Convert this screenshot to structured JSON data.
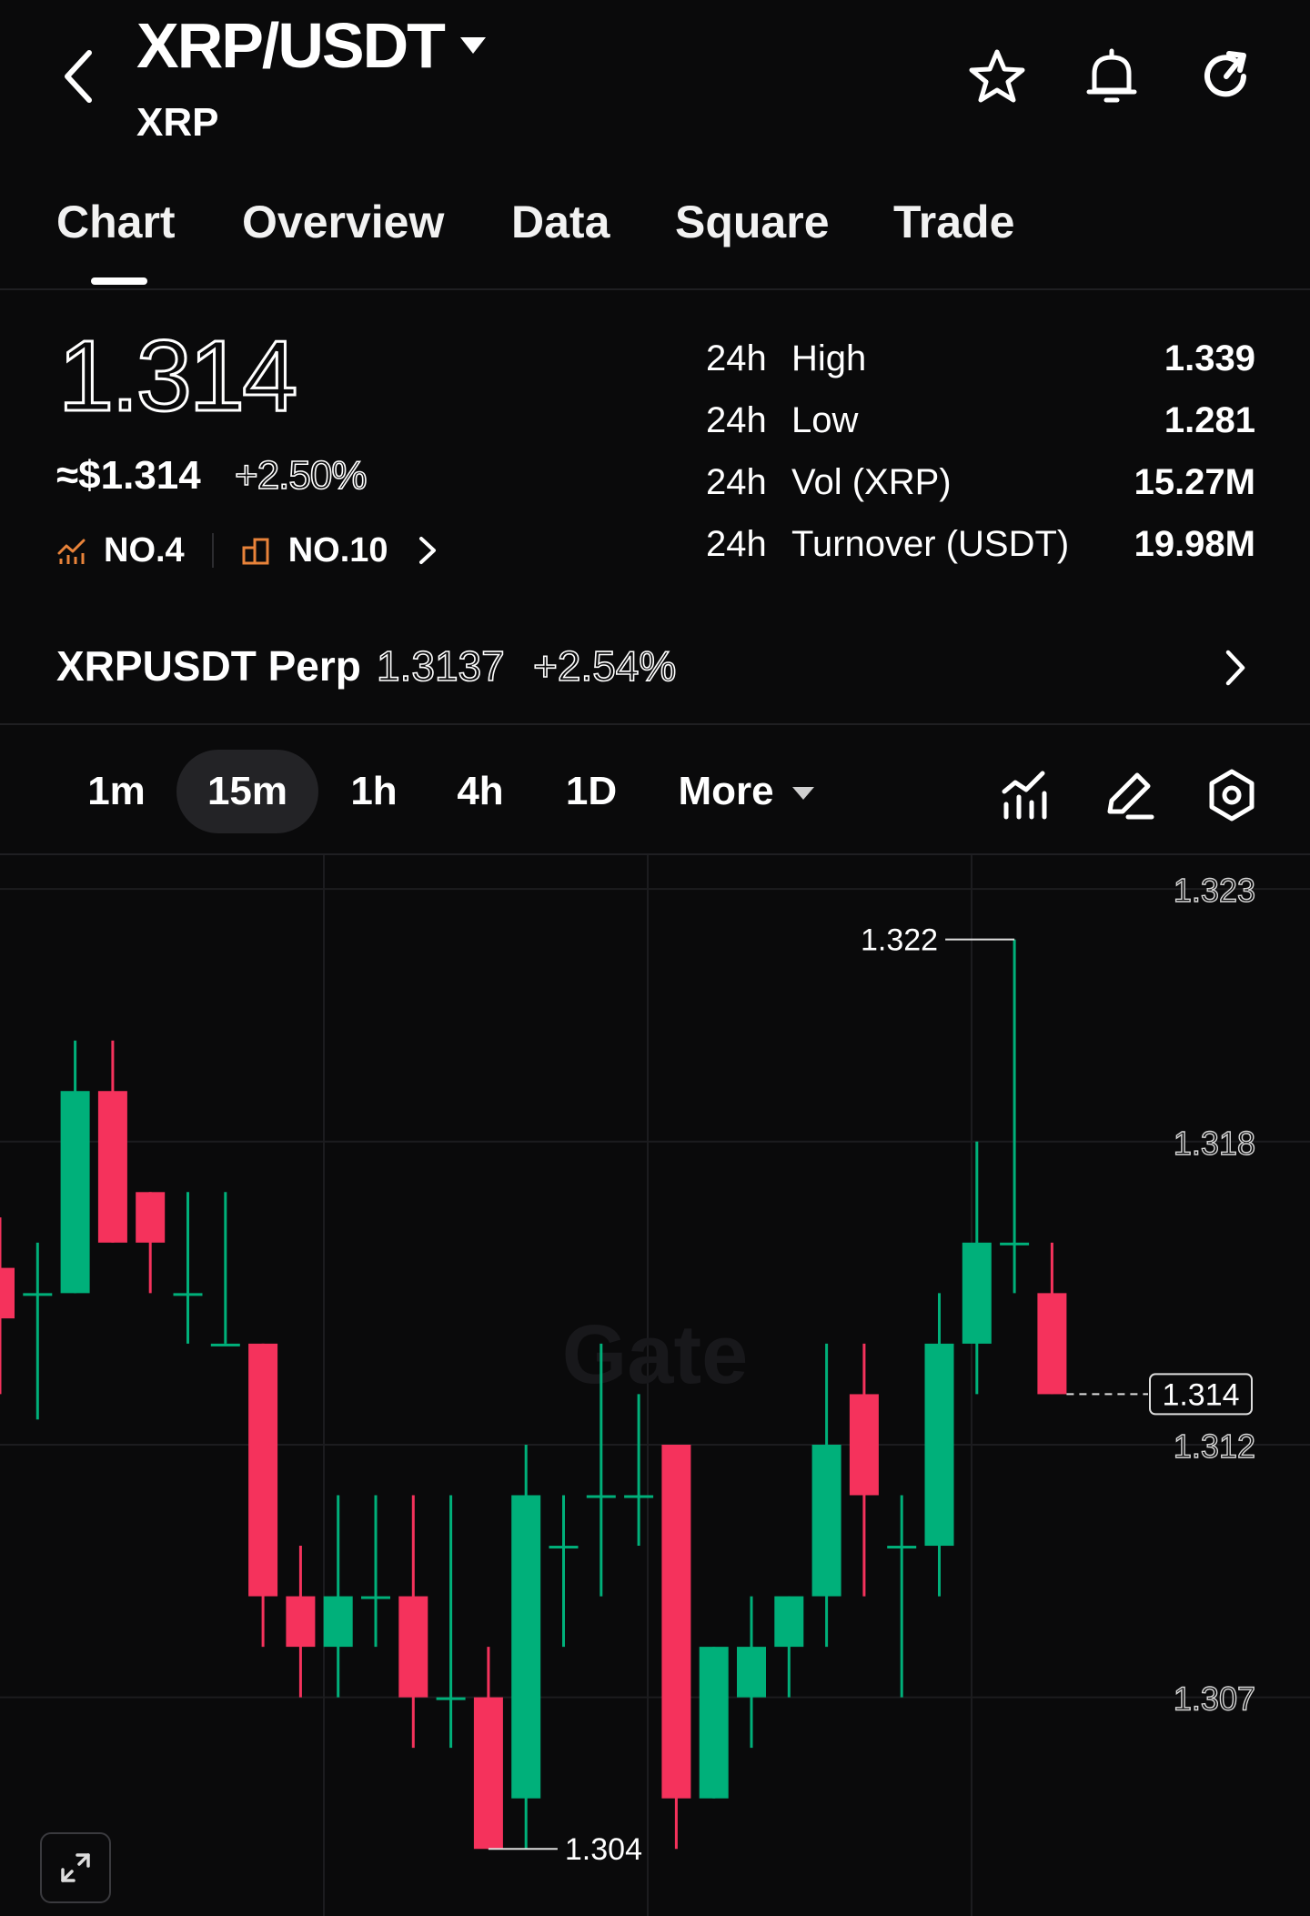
{
  "header": {
    "pair": "XRP/USDT",
    "base": "XRP",
    "icons": [
      "back-arrow-icon",
      "star-icon",
      "bell-icon",
      "refresh-icon"
    ]
  },
  "tabs": [
    {
      "label": "Chart",
      "active": true
    },
    {
      "label": "Overview",
      "active": false
    },
    {
      "label": "Data",
      "active": false
    },
    {
      "label": "Square",
      "active": false
    },
    {
      "label": "Trade",
      "active": false
    }
  ],
  "price": {
    "last": "1.314",
    "usd": "≈$1.314",
    "change": "+2.50%",
    "rank1": "NO.4",
    "rank2": "NO.10"
  },
  "stats": [
    {
      "period": "24h",
      "label": "High",
      "value": "1.339"
    },
    {
      "period": "24h",
      "label": "Low",
      "value": "1.281"
    },
    {
      "period": "24h",
      "label": "Vol (XRP)",
      "value": "15.27M"
    },
    {
      "period": "24h",
      "label": "Turnover (USDT)",
      "value": "19.98M"
    }
  ],
  "perp": {
    "name": "XRPUSDT Perp",
    "price": "1.3137",
    "change": "+2.54%"
  },
  "intervals": [
    {
      "label": "1m",
      "active": false
    },
    {
      "label": "15m",
      "active": true
    },
    {
      "label": "1h",
      "active": false
    },
    {
      "label": "4h",
      "active": false
    },
    {
      "label": "1D",
      "active": false
    },
    {
      "label": "More",
      "active": false
    }
  ],
  "colors": {
    "up": "#00b07a",
    "down": "#f5325c",
    "background": "#0a0a0b",
    "grid": "#1c1c1f"
  },
  "chart_data": {
    "type": "candlestick",
    "watermark": "Gate",
    "y_ticks": [
      1.323,
      1.318,
      1.312,
      1.307
    ],
    "ylim": [
      1.3035,
      1.3232
    ],
    "last_price_label": "1.314",
    "high_label": "1.322",
    "low_label": "1.304",
    "candles": [
      {
        "o": 1.3155,
        "h": 1.3165,
        "l": 1.313,
        "c": 1.3145
      },
      {
        "o": 1.315,
        "h": 1.316,
        "l": 1.3125,
        "c": 1.315
      },
      {
        "o": 1.315,
        "h": 1.32,
        "l": 1.315,
        "c": 1.319
      },
      {
        "o": 1.319,
        "h": 1.32,
        "l": 1.316,
        "c": 1.316
      },
      {
        "o": 1.317,
        "h": 1.317,
        "l": 1.315,
        "c": 1.316
      },
      {
        "o": 1.315,
        "h": 1.317,
        "l": 1.314,
        "c": 1.315
      },
      {
        "o": 1.314,
        "h": 1.317,
        "l": 1.314,
        "c": 1.314
      },
      {
        "o": 1.314,
        "h": 1.314,
        "l": 1.308,
        "c": 1.309
      },
      {
        "o": 1.309,
        "h": 1.31,
        "l": 1.307,
        "c": 1.308
      },
      {
        "o": 1.308,
        "h": 1.311,
        "l": 1.307,
        "c": 1.309
      },
      {
        "o": 1.309,
        "h": 1.311,
        "l": 1.308,
        "c": 1.309
      },
      {
        "o": 1.309,
        "h": 1.311,
        "l": 1.306,
        "c": 1.307
      },
      {
        "o": 1.307,
        "h": 1.311,
        "l": 1.306,
        "c": 1.307
      },
      {
        "o": 1.307,
        "h": 1.308,
        "l": 1.304,
        "c": 1.304
      },
      {
        "o": 1.305,
        "h": 1.312,
        "l": 1.304,
        "c": 1.311
      },
      {
        "o": 1.31,
        "h": 1.311,
        "l": 1.308,
        "c": 1.31
      },
      {
        "o": 1.311,
        "h": 1.314,
        "l": 1.309,
        "c": 1.311
      },
      {
        "o": 1.311,
        "h": 1.313,
        "l": 1.31,
        "c": 1.311
      },
      {
        "o": 1.312,
        "h": 1.312,
        "l": 1.304,
        "c": 1.305
      },
      {
        "o": 1.305,
        "h": 1.308,
        "l": 1.305,
        "c": 1.308
      },
      {
        "o": 1.307,
        "h": 1.309,
        "l": 1.306,
        "c": 1.308
      },
      {
        "o": 1.308,
        "h": 1.309,
        "l": 1.307,
        "c": 1.309
      },
      {
        "o": 1.309,
        "h": 1.314,
        "l": 1.308,
        "c": 1.312
      },
      {
        "o": 1.313,
        "h": 1.314,
        "l": 1.309,
        "c": 1.311
      },
      {
        "o": 1.31,
        "h": 1.311,
        "l": 1.307,
        "c": 1.31
      },
      {
        "o": 1.31,
        "h": 1.315,
        "l": 1.309,
        "c": 1.314
      },
      {
        "o": 1.314,
        "h": 1.318,
        "l": 1.313,
        "c": 1.316
      },
      {
        "o": 1.316,
        "h": 1.322,
        "l": 1.315,
        "c": 1.316
      },
      {
        "o": 1.315,
        "h": 1.316,
        "l": 1.313,
        "c": 1.313
      }
    ]
  }
}
